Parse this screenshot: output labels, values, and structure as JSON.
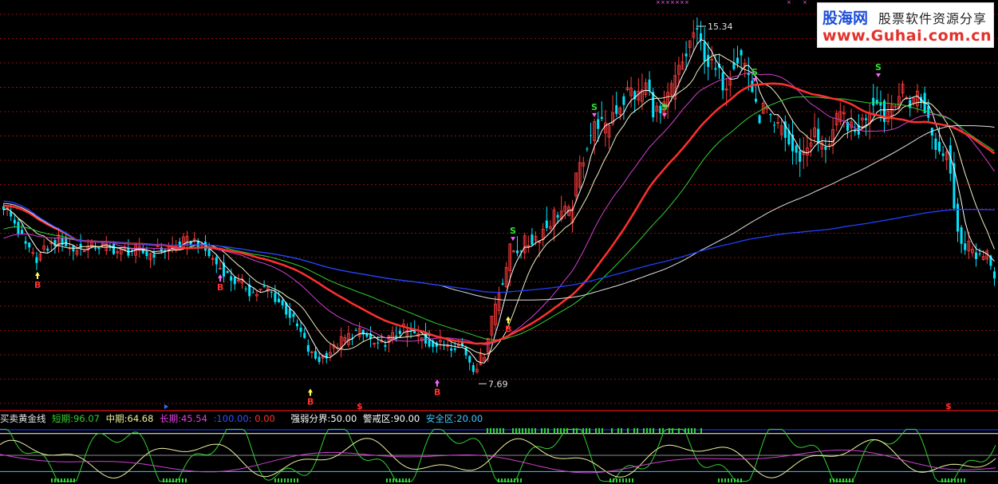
{
  "chart_data": {
    "type": "candlestick",
    "title": "",
    "price_labels": {
      "high": "15.34",
      "low": "7.69"
    },
    "ylim": [
      7.2,
      15.8
    ],
    "signals_buy_label": "B",
    "signals_sell_label": "S",
    "sell_signal_dollar": "$",
    "indicator": {
      "name": "买卖黄金线",
      "short_label": "短期:",
      "short_value": "96.07",
      "mid_label": "中期:",
      "mid_value": "64.68",
      "long_label": "长期:",
      "long_value": "45.54",
      "extra1": ":100.00",
      "extra2": ": 0.00",
      "strong_label": "强弱分界:",
      "strong_value": "50.00",
      "warn_label": "警戒区:",
      "warn_value": "90.00",
      "safe_label": "安全区:",
      "safe_value": "20.00",
      "ylim": [
        0,
        100
      ]
    }
  },
  "watermark": {
    "logo": "股海网",
    "tagline": "股票软件资源分享",
    "url": "www.Guhai.com.cn"
  },
  "colors": {
    "up": "#ff3c3c",
    "down": "#00e5ff",
    "ma_short": "#ffffff",
    "ma_mid": "#ff3030",
    "ma_purple": "#d040d0",
    "ma_green": "#30d030",
    "ma_white_long": "#e0e0e0",
    "ma_blue": "#2040ff",
    "grid": "#8a1010",
    "ind_short": "#30d030",
    "ind_mid": "#f0f0a0",
    "ind_long": "#d040d0"
  }
}
